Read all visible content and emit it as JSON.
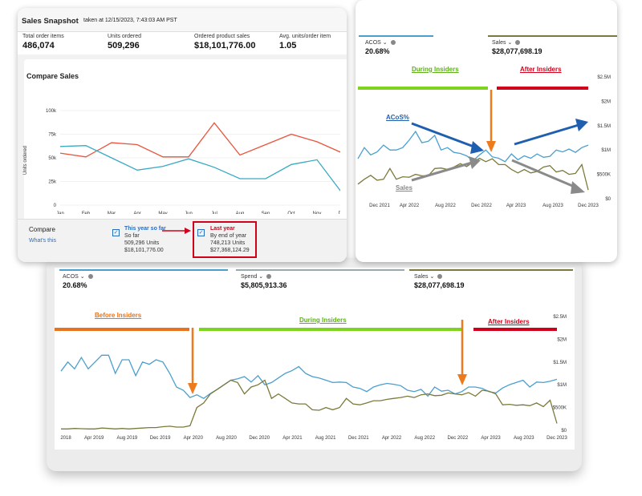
{
  "snapshot": {
    "title": "Sales Snapshot",
    "taken": "taken at 12/15/2023, 7:43:03 AM PST",
    "metrics": [
      {
        "label": "Total order items",
        "value": "486,074"
      },
      {
        "label": "Units ordered",
        "value": "509,296"
      },
      {
        "label": "Ordered product sales",
        "value": "$18,101,776.00"
      },
      {
        "label": "Avg. units/order item",
        "value": "1.05"
      }
    ],
    "compare_title": "Compare Sales",
    "compare_label": "Compare",
    "whats_this": "What's this",
    "this_year": {
      "title": "This year so far",
      "sub": "So far",
      "units": "509,296 Units",
      "sales": "$18,101,776.00"
    },
    "last_year": {
      "title": "Last year",
      "sub": "By end of year",
      "units": "748,213 Units",
      "sales": "$27,368,124.29"
    },
    "y_ticks": [
      "100k",
      "75k",
      "50k",
      "25k",
      "0"
    ],
    "y_axis_label": "Units ordered",
    "months": [
      "Jan",
      "Feb",
      "Mar",
      "Apr",
      "May",
      "Jun",
      "Jul",
      "Aug",
      "Sep",
      "Oct",
      "Nov",
      "Dec"
    ],
    "colors": {
      "this_year": "#3aa9c2",
      "last_year": "#e8553d"
    }
  },
  "right": {
    "kpis": [
      {
        "label": "ACOS",
        "value": "20.68%"
      },
      {
        "label": "Sales",
        "value": "$28,077,698.19"
      }
    ],
    "annotations": {
      "during": "During Insiders",
      "after": "After Insiders",
      "acos": "ACoS%",
      "sales": "Sales"
    },
    "y_ticks": [
      "$2.5M",
      "$2M",
      "$1.5M",
      "$1M",
      "$500K",
      "$0"
    ],
    "x_ticks": [
      "Dec 2021",
      "Apr 2022",
      "Aug 2022",
      "Dec 2022",
      "Apr 2023",
      "Aug 2023",
      "Dec 2023"
    ]
  },
  "bottom": {
    "kpis": [
      {
        "label": "ACOS",
        "value": "20.68%"
      },
      {
        "label": "Spend",
        "value": "$5,805,913.36"
      },
      {
        "label": "Sales",
        "value": "$28,077,698.19"
      }
    ],
    "annotations": {
      "before": "Before Insiders",
      "during": "During Insiders",
      "after": "After Insiders"
    },
    "y_ticks": [
      "$2.5M",
      "$2M",
      "$1.5M",
      "$1M",
      "$500K",
      "$0"
    ],
    "x_ticks": [
      "2018",
      "Apr 2019",
      "Aug 2019",
      "Dec 2019",
      "Apr 2020",
      "Aug 2020",
      "Dec 2020",
      "Apr 2021",
      "Aug 2021",
      "Dec 2021",
      "Apr 2022",
      "Aug 2022",
      "Dec 2022",
      "Apr 2023",
      "Aug 2023",
      "Dec 2023"
    ]
  },
  "colors": {
    "before": "#e8731e",
    "during": "#7ed321",
    "after": "#d0021b",
    "acos_line": "#4a9fcf",
    "sales_line": "#7c7a3a",
    "blue_arrow": "#1f5fb0",
    "gray_arrow": "#8a8a8a",
    "orange_arrow": "#ee7a1e"
  }
}
